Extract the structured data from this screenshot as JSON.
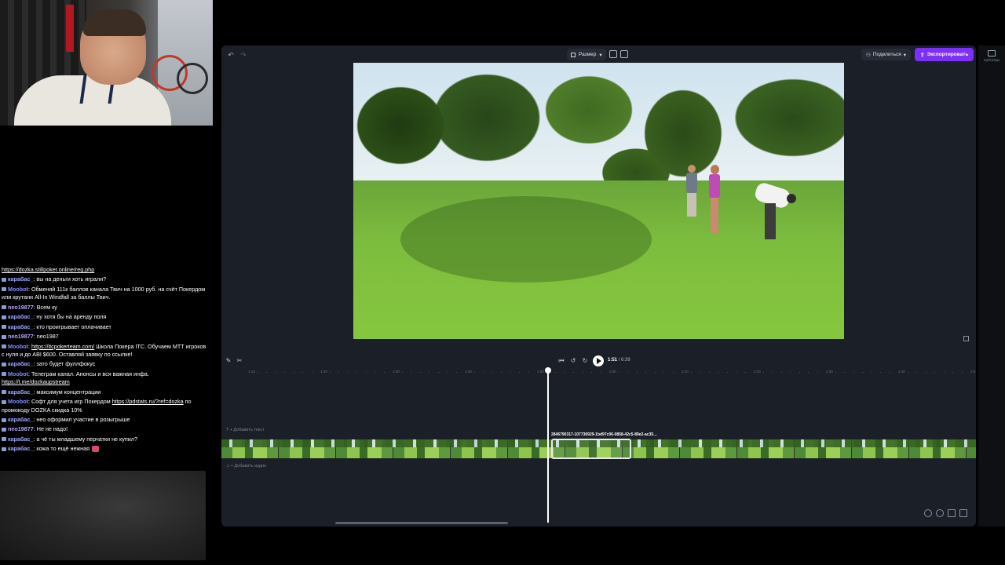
{
  "chat": {
    "messages": [
      {
        "user": "",
        "text": "https://dozka.stillpoker.online/reg.php",
        "is_link": true
      },
      {
        "user": "карабас_",
        "text": ": вы на деньги хоть играли?"
      },
      {
        "user": "Moobot",
        "text": ": Обменяй 111к баллов канала Твич на 1000 руб. на счёт Покердом или крутани All-In Windfall за баллы Твич."
      },
      {
        "user": "neo19877",
        "text": ": Всем ку"
      },
      {
        "user": "карабас_",
        "text": ": ну хотя бы на аренду поля"
      },
      {
        "user": "карабас_",
        "text": ": кто проигрывает оплачивает"
      },
      {
        "user": "neo19877",
        "text": ": neo1987"
      },
      {
        "user": "Moobot",
        "text": ": ",
        "link": "https://itcpokerteam.com/",
        "text2": " Школа Покера ITC. Обучаем МТТ игроков с нуля и до ABI $600. Оставляй заявку по ссылке!"
      },
      {
        "user": "карабас_",
        "text": ": зато будет фуллфокус"
      },
      {
        "user": "Moobot",
        "text": ": Телеграм канал. Анонсы и вся важная инфа.",
        "link_after": "https://t.me/dozkaupstream"
      },
      {
        "user": "карабас_",
        "text": ": максимум концентрации"
      },
      {
        "user": "Moobot",
        "text": ": Софт для учета игр Покердом ",
        "link": "https://pdstats.ru/?ref=dozka",
        "text2": " по промокоду DOZKA скидка 10%"
      },
      {
        "user": "карабас_",
        "text": ": нео оформил участие в розыгрыше"
      },
      {
        "user": "neo19877",
        "text": ": Не не надо!"
      },
      {
        "user": "карабас_",
        "text": ": а чё ты младшему перчатки не купил?"
      },
      {
        "user": "карабас_",
        "text": ": кожа то ещё нежная",
        "emoji": true
      }
    ]
  },
  "editor": {
    "size_label": "Размер",
    "share_label": "Поделиться",
    "export_label": "Экспортировать",
    "captions_label": "Субтитры",
    "time_current": "1:51",
    "time_total": "/ 6:39",
    "ruler_ticks": [
      "1:10",
      "1:20",
      "1:30",
      "1:40",
      "1:50",
      "2:00",
      "2:10",
      "2:20",
      "2:30",
      "2:40",
      "2:5"
    ],
    "add_text_label": "+ Добавить текст",
    "add_audio_label": "+ Добавить аудио",
    "clip_name": "2846790317-107736929-1bd97c06-0858-42c5-89e2-ac35…"
  },
  "colors": {
    "accent": "#7b2ff7",
    "editor_bg": "#1b1f27",
    "chat_user": "#9aa7ff"
  }
}
